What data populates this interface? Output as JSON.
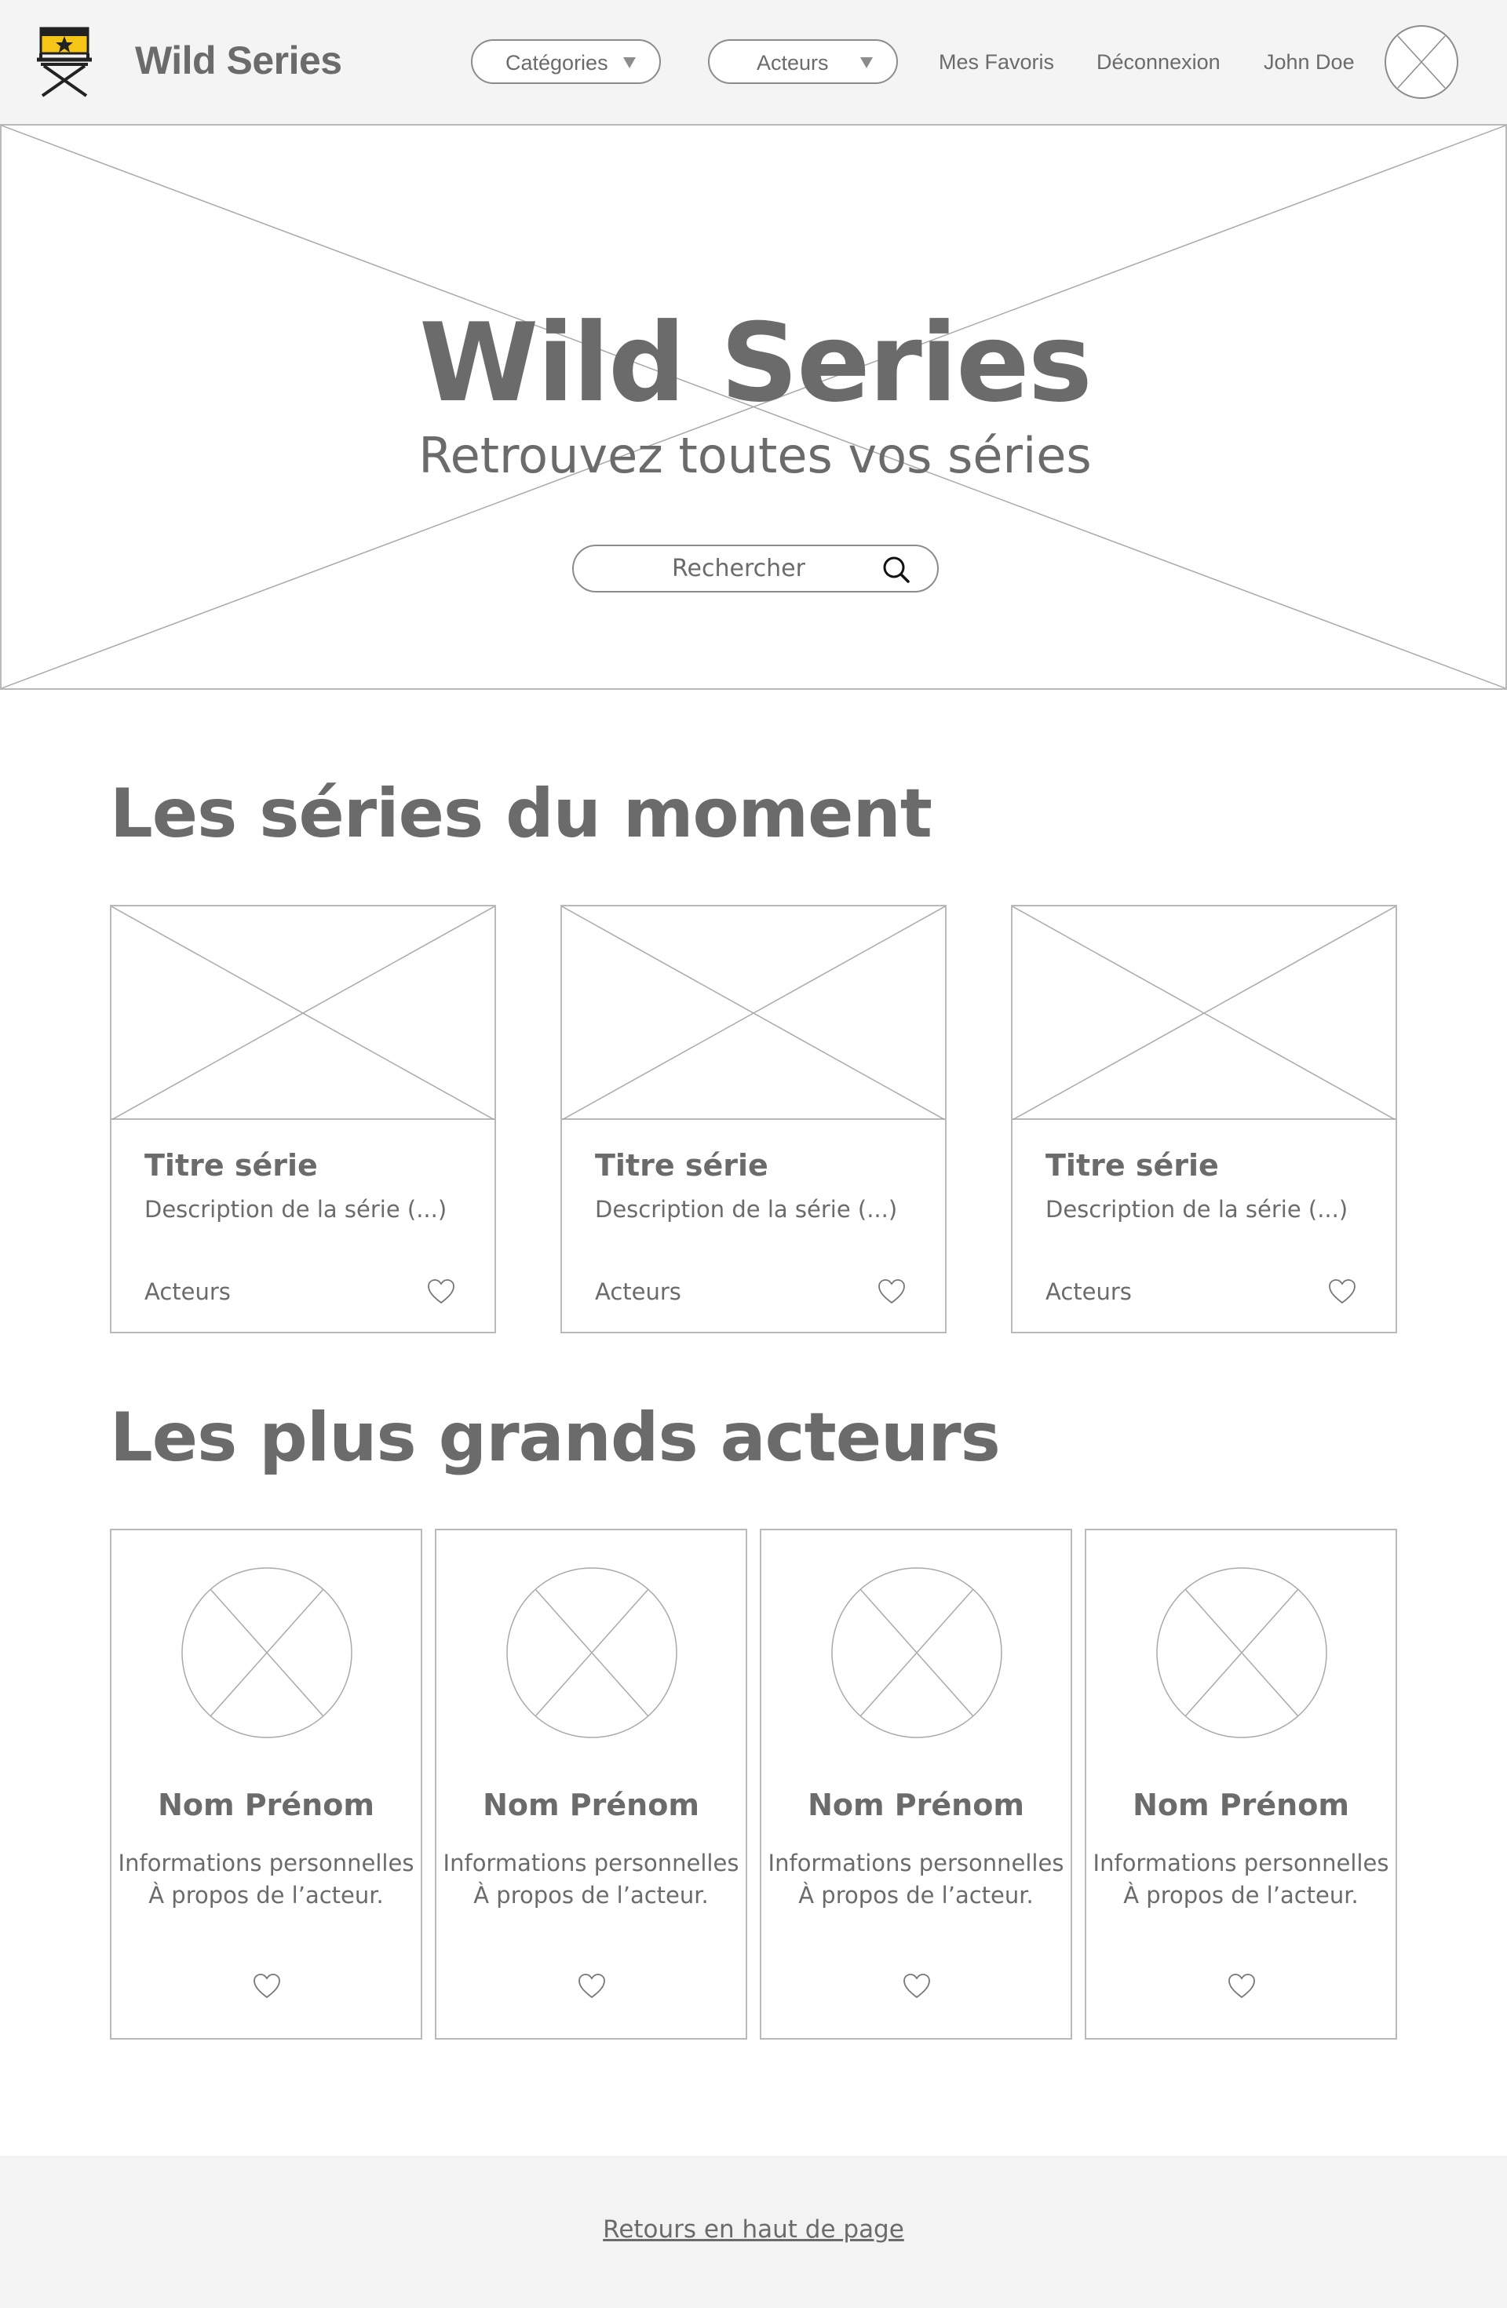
{
  "header": {
    "brand": "Wild Series",
    "nav": {
      "categories_label": "Catégories",
      "actors_label": "Acteurs",
      "favorites_label": "Mes Favoris",
      "logout_label": "Déconnexion",
      "user_name": "John Doe"
    }
  },
  "hero": {
    "title": "Wild Series",
    "subtitle": "Retrouvez toutes vos séries",
    "search_placeholder": "Rechercher"
  },
  "series_section": {
    "title": "Les séries du moment",
    "cards": [
      {
        "title": "Titre série",
        "description": "Description de la série (...)",
        "actors_label": "Acteurs"
      },
      {
        "title": "Titre série",
        "description": "Description de la série (...)",
        "actors_label": "Acteurs"
      },
      {
        "title": "Titre série",
        "description": "Description de la série (...)",
        "actors_label": "Acteurs"
      }
    ]
  },
  "actors_section": {
    "title": "Les plus grands acteurs",
    "cards": [
      {
        "name": "Nom Prénom",
        "info_line1": "Informations personnelles",
        "info_line2": "À propos de l’acteur."
      },
      {
        "name": "Nom Prénom",
        "info_line1": "Informations personnelles",
        "info_line2": "À propos de l’acteur."
      },
      {
        "name": "Nom Prénom",
        "info_line1": "Informations personnelles",
        "info_line2": "À propos de l’acteur."
      },
      {
        "name": "Nom Prénom",
        "info_line1": "Informations personnelles",
        "info_line2": "À propos de l’acteur."
      }
    ]
  },
  "footer": {
    "back_to_top_label": "Retours en haut de page"
  },
  "icons": {
    "logo": "director-chair-icon",
    "avatar": "avatar-placeholder-icon",
    "search": "search-icon",
    "favorite": "heart-icon",
    "dropdown": "caret-down-icon"
  },
  "colors": {
    "text": "#6b6b6b",
    "header_bg": "#f4f4f4",
    "border": "#b9b9b9",
    "logo_accent": "#f5c518",
    "footer_bg": "#f3f3f3"
  }
}
